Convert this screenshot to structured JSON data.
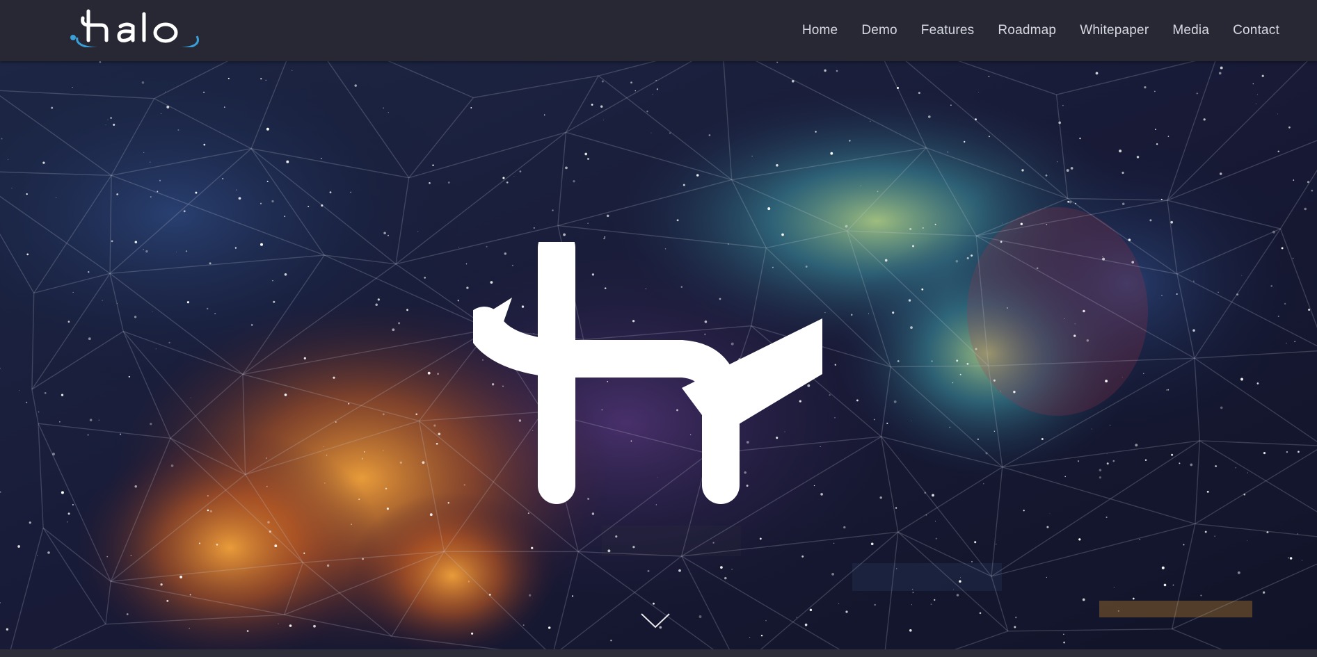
{
  "brand": {
    "logo_text": "halo",
    "logo_color": "#3a9fd6"
  },
  "nav": {
    "items": [
      {
        "label": "Home"
      },
      {
        "label": "Demo"
      },
      {
        "label": "Features"
      },
      {
        "label": "Roadmap"
      },
      {
        "label": "Whitepaper"
      },
      {
        "label": "Media"
      },
      {
        "label": "Contact"
      }
    ]
  },
  "hero": {
    "mark_icon": "halo-h-mark-icon",
    "scroll_icon": "chevron-down-icon",
    "background_colors": [
      "#101430",
      "#2a1f4a",
      "#e08a2a",
      "#4aa0b0"
    ]
  }
}
